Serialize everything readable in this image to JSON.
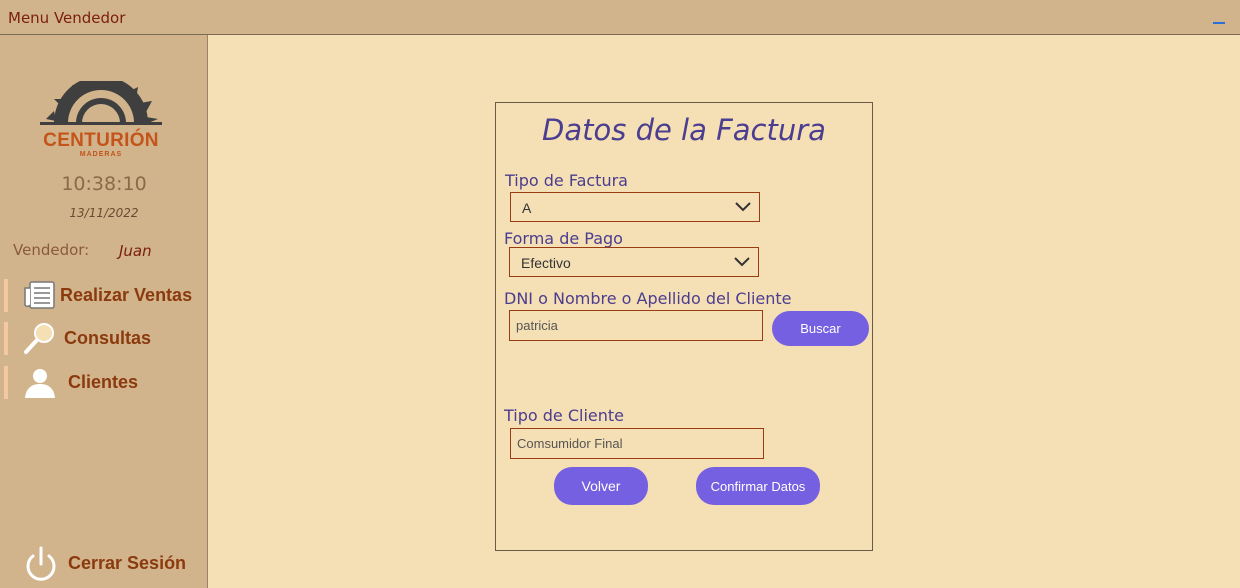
{
  "window": {
    "title": "Menu Vendedor"
  },
  "sidebar": {
    "brand": "CENTURIÓN",
    "brand_sub": "MADERAS",
    "time": "10:38:10",
    "date": "13/11/2022",
    "vendor_label": "Vendedor:",
    "vendor_name": "Juan",
    "items": [
      {
        "label": "Realizar Ventas",
        "icon": "newspaper-icon"
      },
      {
        "label": "Consultas",
        "icon": "magnifier-icon"
      },
      {
        "label": "Clientes",
        "icon": "user-icon"
      }
    ],
    "logout_label": "Cerrar Sesión"
  },
  "form": {
    "title": "Datos de la Factura",
    "invoice_type_label": "Tipo de Factura",
    "invoice_type_value": "A",
    "payment_label": "Forma de Pago",
    "payment_value": "Efectivo",
    "client_search_label": "DNI o Nombre o Apellido del Cliente",
    "client_search_value": "patricia",
    "search_button": "Buscar",
    "client_type_label": "Tipo de Cliente",
    "client_type_value": "Comsumidor Final",
    "back_button": "Volver",
    "confirm_button": "Confirmar Datos"
  },
  "colors": {
    "sidebar_bg": "#d2b48c",
    "content_bg": "#f5dfb4",
    "accent_button": "#7460e0",
    "label_text": "#4b3d8f",
    "nav_text": "#8b3a0e"
  }
}
